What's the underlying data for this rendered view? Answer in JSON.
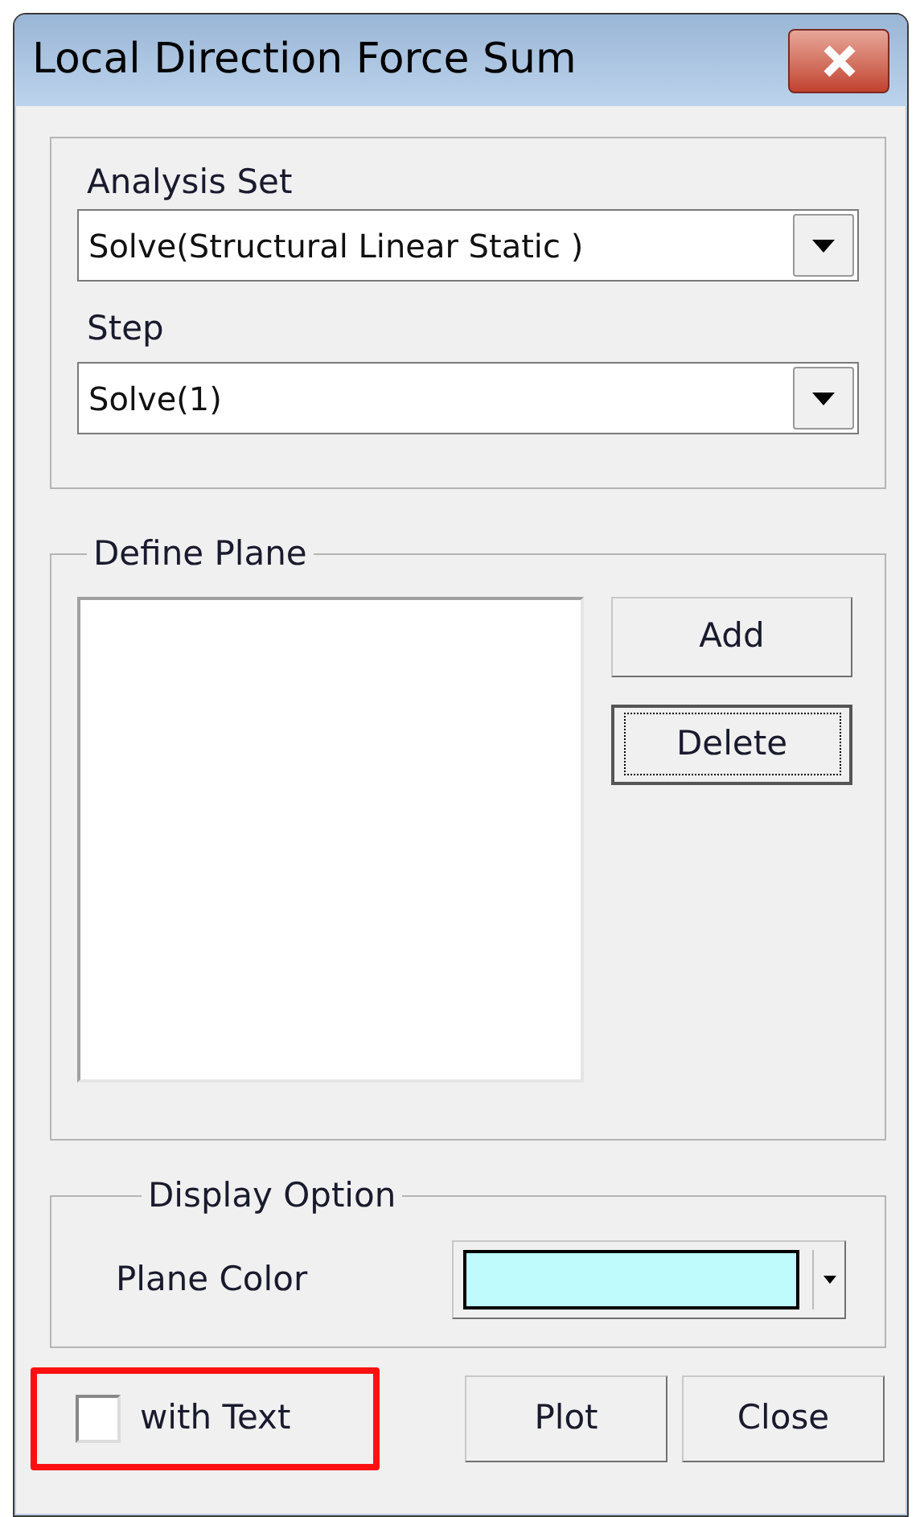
{
  "window": {
    "title": "Local Direction Force Sum"
  },
  "analysis": {
    "analysis_set_label": "Analysis Set",
    "analysis_set": "Solve(Structural Linear Static )",
    "step_label": "Step",
    "step": "Solve(1)"
  },
  "define_plane": {
    "title": "Define Plane",
    "buttons": [
      {
        "label": "Add",
        "focused": false
      },
      {
        "label": "Delete",
        "focused": true
      }
    ]
  },
  "display_option": {
    "title": "Display Option",
    "plane_color_label": "Plane Color",
    "plane_color": {
      "color": "#bffafc"
    }
  },
  "with_text": {
    "label": "with Text",
    "checked": false,
    "highlighted": true
  },
  "buttons": [
    "Plot",
    "Close"
  ]
}
